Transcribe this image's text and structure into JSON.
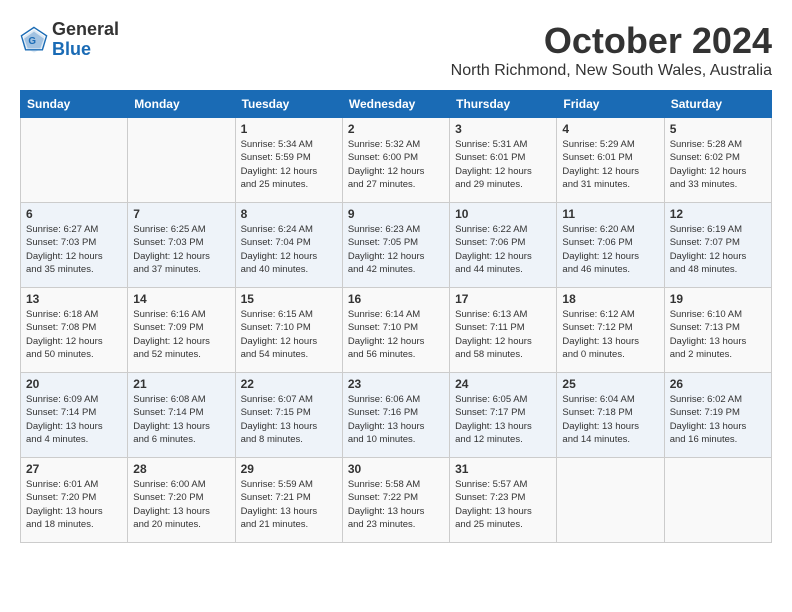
{
  "header": {
    "logo_line1": "General",
    "logo_line2": "Blue",
    "title": "October 2024",
    "subtitle": "North Richmond, New South Wales, Australia"
  },
  "days_of_week": [
    "Sunday",
    "Monday",
    "Tuesday",
    "Wednesday",
    "Thursday",
    "Friday",
    "Saturday"
  ],
  "weeks": [
    [
      {
        "day": "",
        "info": ""
      },
      {
        "day": "",
        "info": ""
      },
      {
        "day": "1",
        "info": "Sunrise: 5:34 AM\nSunset: 5:59 PM\nDaylight: 12 hours\nand 25 minutes."
      },
      {
        "day": "2",
        "info": "Sunrise: 5:32 AM\nSunset: 6:00 PM\nDaylight: 12 hours\nand 27 minutes."
      },
      {
        "day": "3",
        "info": "Sunrise: 5:31 AM\nSunset: 6:01 PM\nDaylight: 12 hours\nand 29 minutes."
      },
      {
        "day": "4",
        "info": "Sunrise: 5:29 AM\nSunset: 6:01 PM\nDaylight: 12 hours\nand 31 minutes."
      },
      {
        "day": "5",
        "info": "Sunrise: 5:28 AM\nSunset: 6:02 PM\nDaylight: 12 hours\nand 33 minutes."
      }
    ],
    [
      {
        "day": "6",
        "info": "Sunrise: 6:27 AM\nSunset: 7:03 PM\nDaylight: 12 hours\nand 35 minutes."
      },
      {
        "day": "7",
        "info": "Sunrise: 6:25 AM\nSunset: 7:03 PM\nDaylight: 12 hours\nand 37 minutes."
      },
      {
        "day": "8",
        "info": "Sunrise: 6:24 AM\nSunset: 7:04 PM\nDaylight: 12 hours\nand 40 minutes."
      },
      {
        "day": "9",
        "info": "Sunrise: 6:23 AM\nSunset: 7:05 PM\nDaylight: 12 hours\nand 42 minutes."
      },
      {
        "day": "10",
        "info": "Sunrise: 6:22 AM\nSunset: 7:06 PM\nDaylight: 12 hours\nand 44 minutes."
      },
      {
        "day": "11",
        "info": "Sunrise: 6:20 AM\nSunset: 7:06 PM\nDaylight: 12 hours\nand 46 minutes."
      },
      {
        "day": "12",
        "info": "Sunrise: 6:19 AM\nSunset: 7:07 PM\nDaylight: 12 hours\nand 48 minutes."
      }
    ],
    [
      {
        "day": "13",
        "info": "Sunrise: 6:18 AM\nSunset: 7:08 PM\nDaylight: 12 hours\nand 50 minutes."
      },
      {
        "day": "14",
        "info": "Sunrise: 6:16 AM\nSunset: 7:09 PM\nDaylight: 12 hours\nand 52 minutes."
      },
      {
        "day": "15",
        "info": "Sunrise: 6:15 AM\nSunset: 7:10 PM\nDaylight: 12 hours\nand 54 minutes."
      },
      {
        "day": "16",
        "info": "Sunrise: 6:14 AM\nSunset: 7:10 PM\nDaylight: 12 hours\nand 56 minutes."
      },
      {
        "day": "17",
        "info": "Sunrise: 6:13 AM\nSunset: 7:11 PM\nDaylight: 12 hours\nand 58 minutes."
      },
      {
        "day": "18",
        "info": "Sunrise: 6:12 AM\nSunset: 7:12 PM\nDaylight: 13 hours\nand 0 minutes."
      },
      {
        "day": "19",
        "info": "Sunrise: 6:10 AM\nSunset: 7:13 PM\nDaylight: 13 hours\nand 2 minutes."
      }
    ],
    [
      {
        "day": "20",
        "info": "Sunrise: 6:09 AM\nSunset: 7:14 PM\nDaylight: 13 hours\nand 4 minutes."
      },
      {
        "day": "21",
        "info": "Sunrise: 6:08 AM\nSunset: 7:14 PM\nDaylight: 13 hours\nand 6 minutes."
      },
      {
        "day": "22",
        "info": "Sunrise: 6:07 AM\nSunset: 7:15 PM\nDaylight: 13 hours\nand 8 minutes."
      },
      {
        "day": "23",
        "info": "Sunrise: 6:06 AM\nSunset: 7:16 PM\nDaylight: 13 hours\nand 10 minutes."
      },
      {
        "day": "24",
        "info": "Sunrise: 6:05 AM\nSunset: 7:17 PM\nDaylight: 13 hours\nand 12 minutes."
      },
      {
        "day": "25",
        "info": "Sunrise: 6:04 AM\nSunset: 7:18 PM\nDaylight: 13 hours\nand 14 minutes."
      },
      {
        "day": "26",
        "info": "Sunrise: 6:02 AM\nSunset: 7:19 PM\nDaylight: 13 hours\nand 16 minutes."
      }
    ],
    [
      {
        "day": "27",
        "info": "Sunrise: 6:01 AM\nSunset: 7:20 PM\nDaylight: 13 hours\nand 18 minutes."
      },
      {
        "day": "28",
        "info": "Sunrise: 6:00 AM\nSunset: 7:20 PM\nDaylight: 13 hours\nand 20 minutes."
      },
      {
        "day": "29",
        "info": "Sunrise: 5:59 AM\nSunset: 7:21 PM\nDaylight: 13 hours\nand 21 minutes."
      },
      {
        "day": "30",
        "info": "Sunrise: 5:58 AM\nSunset: 7:22 PM\nDaylight: 13 hours\nand 23 minutes."
      },
      {
        "day": "31",
        "info": "Sunrise: 5:57 AM\nSunset: 7:23 PM\nDaylight: 13 hours\nand 25 minutes."
      },
      {
        "day": "",
        "info": ""
      },
      {
        "day": "",
        "info": ""
      }
    ]
  ]
}
